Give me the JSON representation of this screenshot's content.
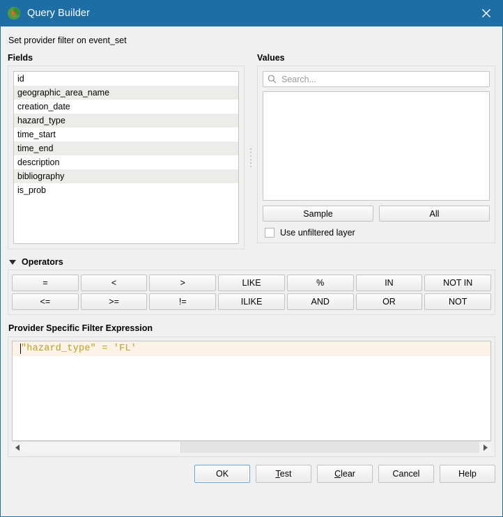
{
  "window": {
    "title": "Query Builder",
    "app_icon": "qgis-icon",
    "close_icon": "close-icon"
  },
  "subtitle": "Set provider filter on event_set",
  "fields": {
    "label": "Fields",
    "items": [
      "id",
      "geographic_area_name",
      "creation_date",
      "hazard_type",
      "time_start",
      "time_end",
      "description",
      "bibliography",
      "is_prob"
    ]
  },
  "values": {
    "label": "Values",
    "search_placeholder": "Search...",
    "search_value": "",
    "search_icon": "search-icon",
    "items": [],
    "sample_label": "Sample",
    "all_label": "All",
    "unfiltered_label": "Use unfiltered layer",
    "unfiltered_checked": false
  },
  "operators": {
    "label": "Operators",
    "expanded": true,
    "rows": [
      [
        "=",
        "<",
        ">",
        "LIKE",
        "%",
        "IN",
        "NOT IN"
      ],
      [
        "<=",
        ">=",
        "!=",
        "ILIKE",
        "AND",
        "OR",
        "NOT"
      ]
    ]
  },
  "expression": {
    "label": "Provider Specific Filter Expression",
    "text": "\"hazard_type\" = 'FL'"
  },
  "footer": {
    "ok": "OK",
    "test_pre": "",
    "test_mn": "T",
    "test_post": "est",
    "clear_pre": "",
    "clear_mn": "C",
    "clear_post": "lear",
    "cancel": "Cancel",
    "help": "Help"
  },
  "colors": {
    "titlebar": "#1c6ea4",
    "expr_text": "#b8a020",
    "expr_line_highlight": "#fdf2e8",
    "row_alt": "#ececea",
    "focus_border": "#64a6d8"
  }
}
